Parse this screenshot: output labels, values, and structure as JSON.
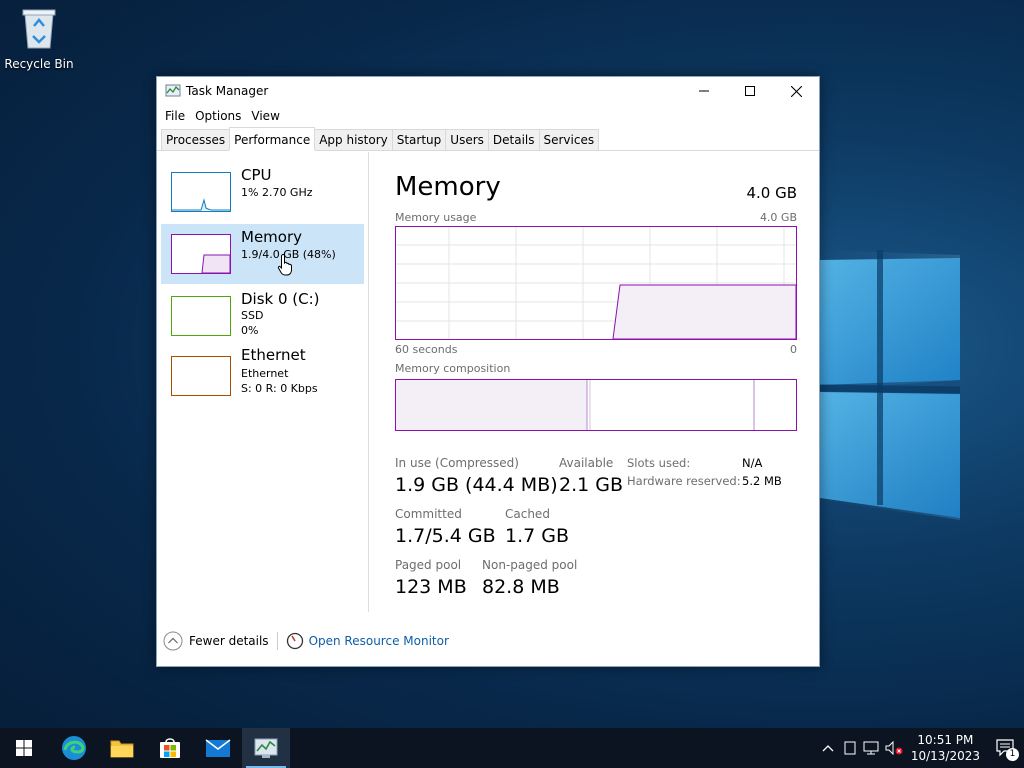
{
  "desktop": {
    "recycle_bin_label": "Recycle Bin"
  },
  "window": {
    "title": "Task Manager",
    "menu": [
      "File",
      "Options",
      "View"
    ],
    "tabs": [
      "Processes",
      "Performance",
      "App history",
      "Startup",
      "Users",
      "Details",
      "Services"
    ],
    "active_tab": "Performance"
  },
  "resources": [
    {
      "name": "CPU",
      "sub1": "1% 2.70 GHz",
      "sub2": "",
      "color": "#117dbb"
    },
    {
      "name": "Memory",
      "sub1": "1.9/4.0 GB (48%)",
      "sub2": "",
      "color": "#8b12ae"
    },
    {
      "name": "Disk 0 (C:)",
      "sub1": "SSD",
      "sub2": "0%",
      "color": "#4da60c"
    },
    {
      "name": "Ethernet",
      "sub1": "Ethernet",
      "sub2": "S: 0 R: 0 Kbps",
      "color": "#a74f01"
    }
  ],
  "memory": {
    "title": "Memory",
    "total": "4.0 GB",
    "usage_label": "Memory usage",
    "usage_max": "4.0 GB",
    "axis_left": "60 seconds",
    "axis_right": "0",
    "composition_label": "Memory composition",
    "usage_fraction": 0.48,
    "stats": {
      "in_use_label": "In use (Compressed)",
      "in_use_value": "1.9 GB (44.4 MB)",
      "available_label": "Available",
      "available_value": "2.1 GB",
      "committed_label": "Committed",
      "committed_value": "1.7/5.4 GB",
      "cached_label": "Cached",
      "cached_value": "1.7 GB",
      "paged_label": "Paged pool",
      "paged_value": "123 MB",
      "nonpaged_label": "Non-paged pool",
      "nonpaged_value": "82.8 MB",
      "slots_label": "Slots used:",
      "slots_value": "N/A",
      "hw_label": "Hardware reserved:",
      "hw_value": "5.2 MB"
    }
  },
  "footer": {
    "fewer_details": "Fewer details",
    "open_monitor": "Open Resource Monitor"
  },
  "taskbar": {
    "time": "10:51 PM",
    "date": "10/13/2023",
    "notification_count": "1"
  },
  "colors": {
    "memory_accent": "#8b12ae",
    "link": "#0d5ea6",
    "selected_bg": "#cce4f7"
  }
}
